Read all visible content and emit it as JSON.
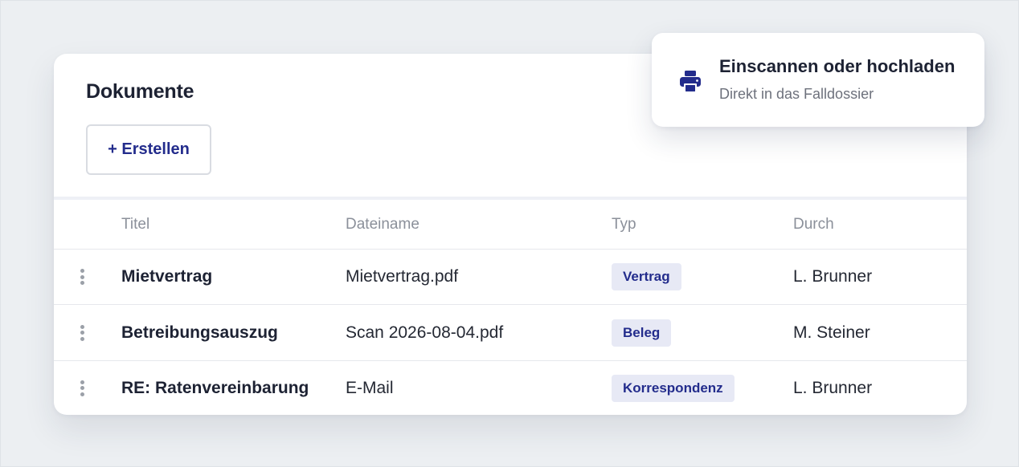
{
  "documents": {
    "title": "Dokumente",
    "create_label": "+ Erstellen",
    "columns": {
      "title": "Titel",
      "filename": "Dateiname",
      "type": "Typ",
      "by": "Durch"
    },
    "rows": [
      {
        "title": "Mietvertrag",
        "filename": "Mietvertrag.pdf",
        "type": "Vertrag",
        "by": "L. Brunner"
      },
      {
        "title": "Betreibungsauszug",
        "filename": "Scan 2026-08-04.pdf",
        "type": "Beleg",
        "by": "M. Steiner"
      },
      {
        "title": "RE: Ratenvereinbarung",
        "filename": "E-Mail",
        "type": "Korrespondenz",
        "by": "L. Brunner"
      }
    ]
  },
  "upload_popover": {
    "icon": "printer-icon",
    "title": "Einscannen oder hochladen",
    "subtitle": "Direkt in das Falldossier"
  },
  "colors": {
    "accent": "#232c8c",
    "badge_bg": "#e7e9f5",
    "background": "#eceff2"
  }
}
